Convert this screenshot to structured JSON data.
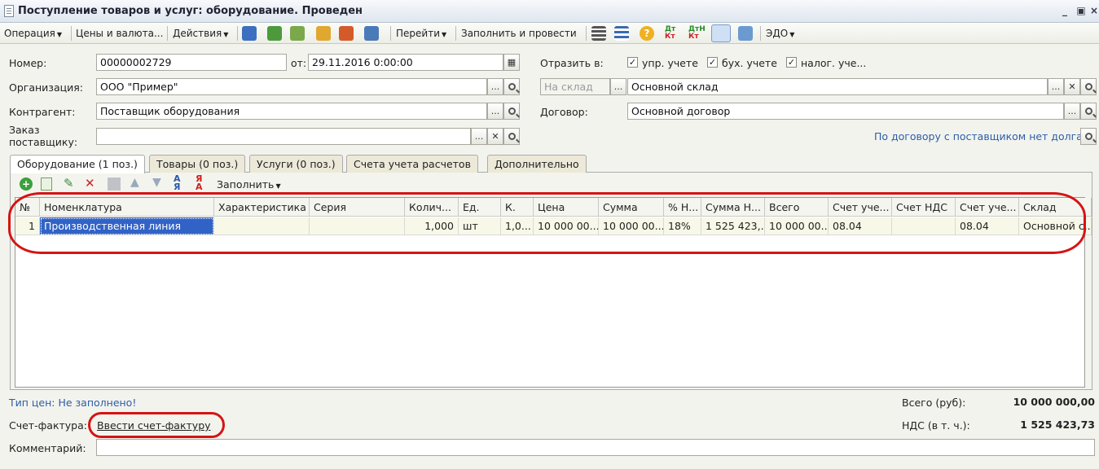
{
  "window": {
    "title": "Поступление товаров и услуг: оборудование. Проведен"
  },
  "toolbar": {
    "operation": "Операция",
    "prices": "Цены и валюта...",
    "actions": "Действия",
    "goto": "Перейти",
    "fill_post": "Заполнить и провести",
    "edo": "ЭДО",
    "icons": [
      "post-icon",
      "refresh-icon",
      "copy-icon",
      "import-icon",
      "export-icon",
      "structure-icon",
      "list-icon",
      "checklist-icon",
      "help-icon",
      "dt-kt-icon",
      "dtn-kt-icon",
      "settings-icon",
      "print-icon"
    ]
  },
  "form": {
    "number_label": "Номер:",
    "number": "00000002729",
    "date_label": "от:",
    "date": "29.11.2016  0:00:00",
    "reflect_label": "Отразить в:",
    "reflect": [
      {
        "label": "упр. учете",
        "checked": true
      },
      {
        "label": "бух. учете",
        "checked": true
      },
      {
        "label": "налог. уче...",
        "checked": true
      }
    ],
    "org_label": "Организация:",
    "org": "ООО \"Пример\"",
    "to_warehouse_placeholder": "На склад",
    "warehouse": "Основной склад",
    "contractor_label": "Контрагент:",
    "contractor": "Поставщик оборудования",
    "contract_label": "Договор:",
    "contract": "Основной договор",
    "order_label_1": "Заказ",
    "order_label_2": "поставщику:",
    "order": "",
    "debt_link": "По договору с поставщиком нет долга"
  },
  "tabs": [
    {
      "label": "Оборудование (1 поз.)",
      "active": true
    },
    {
      "label": "Товары (0 поз.)",
      "active": false
    },
    {
      "label": "Услуги (0 поз.)",
      "active": false
    },
    {
      "label": "Счета учета расчетов",
      "active": false
    },
    {
      "label": "Дополнительно",
      "active": false
    }
  ],
  "table_toolbar": {
    "fill": "Заполнить"
  },
  "table": {
    "headers": [
      "№",
      "Номенклатура",
      "Характеристика",
      "Серия",
      "Колич...",
      "Ед.",
      "К.",
      "Цена",
      "Сумма",
      "% Н...",
      "Сумма Н...",
      "Всего",
      "Счет уче...",
      "Счет НДС",
      "Счет уче...",
      "Склад"
    ],
    "rows": [
      [
        "1",
        "Производственная линия",
        "",
        "",
        "1,000",
        "шт",
        "1,0...",
        "10 000 00...",
        "10 000 00...",
        "18%",
        "1 525 423,...",
        "10 000 00...",
        "08.04",
        "",
        "08.04",
        "Основной с..."
      ]
    ]
  },
  "footer": {
    "price_type": "Тип цен: Не заполнено!",
    "invoice_label": "Счет-фактура:",
    "invoice_link": "Ввести счет-фактуру",
    "comment_label": "Комментарий:",
    "comment": "",
    "total_label": "Всего (руб):",
    "total": "10 000 000,00",
    "vat_label": "НДС (в т. ч.):",
    "vat": "1 525 423,73"
  },
  "colors": {
    "highlight": "#d41414",
    "selection": "#3163c6",
    "link": "#2b5ea8"
  }
}
